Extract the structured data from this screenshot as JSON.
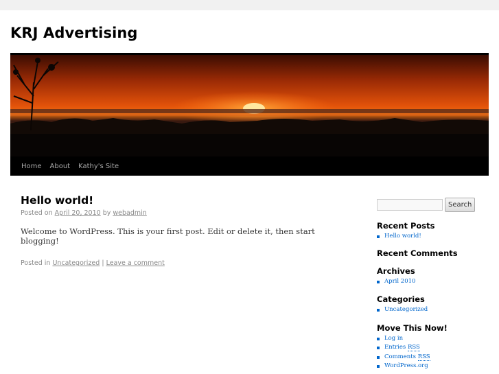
{
  "site": {
    "title": "KRJ Advertising"
  },
  "nav": {
    "items": [
      "Home",
      "About",
      "Kathy's Site"
    ]
  },
  "post": {
    "title": "Hello world!",
    "posted_on": "Posted on",
    "date": "April 20, 2010",
    "by": "by",
    "author": "webadmin",
    "body": "Welcome to WordPress. This is your first post. Edit or delete it, then start blogging!",
    "posted_in": "Posted in",
    "category": "Uncategorized",
    "separator": "|",
    "comment_link": "Leave a comment"
  },
  "sidebar": {
    "search_placeholder": "",
    "search_button": "Search",
    "recent_posts": {
      "title": "Recent Posts",
      "items": [
        "Hello world!"
      ]
    },
    "recent_comments": {
      "title": "Recent Comments"
    },
    "archives": {
      "title": "Archives",
      "items": [
        "April 2010"
      ]
    },
    "categories": {
      "title": "Categories",
      "items": [
        "Uncategorized"
      ]
    },
    "meta": {
      "title": "Move This Now!",
      "login": "Log in",
      "entries_pre": "Entries",
      "entries_abbr": "RSS",
      "comments_pre": "Comments",
      "comments_abbr": "RSS",
      "wordpress": "WordPress.org"
    }
  },
  "colors": {
    "link": "#0066cc",
    "nav_bg": "#000000",
    "meta_text": "#888888"
  }
}
